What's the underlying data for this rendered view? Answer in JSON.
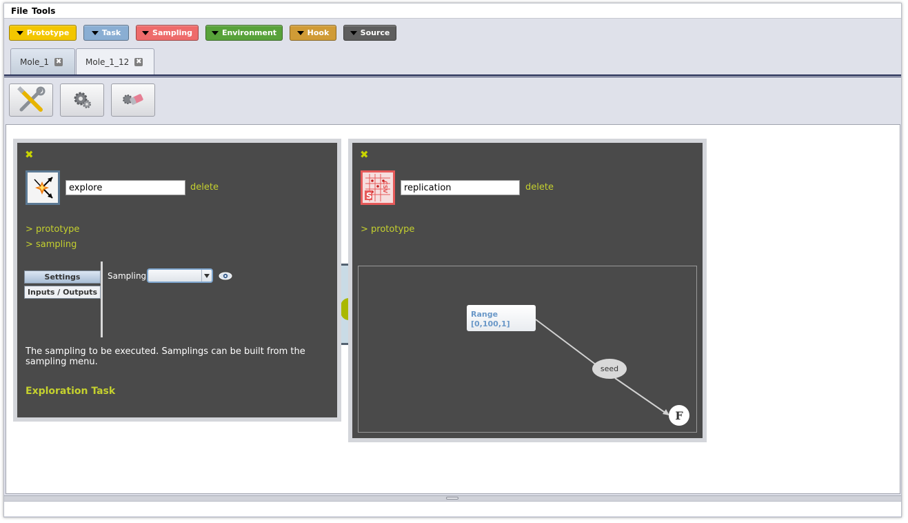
{
  "menu": {
    "items": [
      "File",
      "Tools"
    ]
  },
  "palette": [
    {
      "label": "Prototype",
      "color": "#f3c600",
      "text_color": "#ffffff"
    },
    {
      "label": "Task",
      "color": "#8aaed3",
      "text_color": "#ffffff"
    },
    {
      "label": "Sampling",
      "color": "#ee6b6b",
      "text_color": "#ffffff"
    },
    {
      "label": "Environment",
      "color": "#58a23a",
      "text_color": "#ffffff"
    },
    {
      "label": "Hook",
      "color": "#d09b36",
      "text_color": "#ffffff"
    },
    {
      "label": "Source",
      "color": "#5e5e5e",
      "text_color": "#ffffff"
    }
  ],
  "tabs": [
    {
      "label": "Mole_1",
      "active": true
    },
    {
      "label": "Mole_1_12",
      "active": false
    }
  ],
  "toolbar": [
    {
      "icon": "tools-icon"
    },
    {
      "icon": "gear-icon"
    },
    {
      "icon": "eraser-icon"
    }
  ],
  "explore_panel": {
    "name_value": "explore",
    "delete_label": "delete",
    "links": [
      "> prototype",
      "> sampling"
    ],
    "side_tabs": [
      "Settings",
      "Inputs / Outputs"
    ],
    "sampling_label": "Sampling",
    "sampling_selected": "",
    "description": "The sampling to be executed. Samplings can be built from the sampling menu.",
    "footer": "Exploration Task"
  },
  "replication_panel": {
    "name_value": "replication",
    "delete_label": "delete",
    "links": [
      "> prototype"
    ],
    "graph": {
      "range_title": "Range",
      "range_value": "[0,100,1]",
      "edge_label": "seed",
      "final_node": "F"
    }
  }
}
